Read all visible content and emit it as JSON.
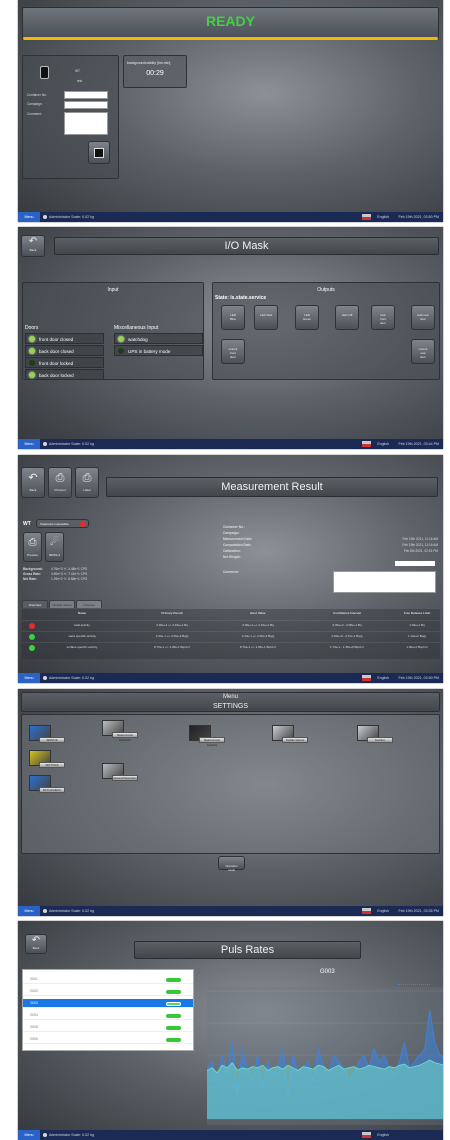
{
  "taskbar": {
    "menu": "Menu",
    "user": "Administrator  Scale: 0.02 kg",
    "language": "English"
  },
  "s1": {
    "status": "READY",
    "device_name": "WT",
    "device_sub": "test",
    "fields": {
      "container_no": "Container No:",
      "campaign": "Campaign:",
      "comment": "Comment:"
    },
    "bg_title": "backgroundvalidity [hrs:min]",
    "bg_value": "00:29",
    "time": "Feb 19th 2021, 03:50 PM"
  },
  "s2": {
    "back": "Back",
    "title": "I/O Mask",
    "input_title": "Input",
    "doors_title": "Doors",
    "doors": [
      {
        "label": "front door closed",
        "on": true
      },
      {
        "label": "back door closed",
        "on": true
      },
      {
        "label": "front door locked",
        "on": false
      },
      {
        "label": "back door locked",
        "on": true
      }
    ],
    "misc_title": "Miscellaneous Input",
    "misc": [
      {
        "label": "watchdog",
        "on": true
      },
      {
        "label": "UPS in battery mode",
        "on": false
      }
    ],
    "outputs_title": "Outputs",
    "state": "State: is.state.service",
    "output_buttons": [
      "LED\nBlue",
      "LED Red",
      "LED\nGreen",
      "LED Off",
      "lock\nfront\ndoor",
      "lock rear\ndoor",
      "unlock\nfront\ndoor",
      "unlock\nrear\ndoor"
    ],
    "time": "Feb 19th 2021, 03:44 PM"
  },
  "s3": {
    "buttons": [
      "Back",
      "Protocol",
      "Label"
    ],
    "title": "Measurement Result",
    "device": "WT",
    "badge": "Clearance impossible",
    "sub_buttons": [
      "Preview",
      "MRSS-2"
    ],
    "stats": [
      {
        "k": "Background:",
        "v": "4.76e+3 +/- 4.48e+1 CPS"
      },
      {
        "k": "Gross Rate:",
        "v": "4.90e+3 +/- 7.41e+1 CPS"
      },
      {
        "k": "Net Rate:",
        "v": "1.29e+2 +/- 8.58e+1 CPS"
      }
    ],
    "info_labels": [
      "Container No.:",
      "Campaign:",
      "Measurement Date:",
      "Computation Date:",
      "Calibration:",
      "Net Weight:",
      "Comment:"
    ],
    "info_values": [
      "",
      "",
      "Feb 19th 2021, 11:16 AM",
      "Feb 19th 2021, 11:16 AM",
      "Feb 8th 2021, 02:15 PM",
      "",
      ""
    ],
    "tabs": [
      "Overview",
      "Nuclide Vector",
      "Channel"
    ],
    "headers": [
      "Name",
      "Primary Result",
      "Best Value",
      "Confidence Interval",
      "Free Release Limit"
    ],
    "rows": [
      {
        "color": "#e52b2b",
        "cells": [
          "total activity",
          "2.30e+1 +/- 2.10e+1 Bq",
          "2.30e+1 +/- 2.10e+1 Bq",
          "0.00e+0 - 2.08e+1 Bq",
          "1.00e+1 Bq"
        ]
      },
      {
        "color": "#3ad13a",
        "cells": [
          "mass specific activity",
          "2.34e-1 +/- 2.06e-2 Bq/g",
          "2.34e-1 +/- 2.06e-2 Bq/g",
          "0.00e+0 - 2.67e-1 Bq/g",
          "1.10e+0 Bq/g"
        ]
      },
      {
        "color": "#3ad13a",
        "cells": [
          "surface specific activity",
          "8.70e-1 +/- 1.05e-1 Bq/cm²",
          "8.70e-1 +/- 1.05e-1 Bq/cm²",
          "1.73e-1 - 1.35e+0 Bq/cm²",
          "1.00e+0 Bq/cm²"
        ]
      }
    ],
    "time": "Feb 19th 2021, 03:50 PM"
  },
  "s4": {
    "menu": "Menu",
    "settings": "SETTINGS",
    "tiles": [
      "SERVICE",
      "Measurement\nParameter",
      "Measurement Capacity",
      "Nuclide Vectors",
      "Nuclides",
      "SETTINGS",
      "General Parameters",
      "BATCHCHECK"
    ],
    "operation": "Operation\nmode",
    "time": "Feb 19th 2021, 03:35 PM"
  },
  "s5": {
    "back": "Back",
    "title": "Puls Rates",
    "items": [
      "G001",
      "G002",
      "G003",
      "G004",
      "G005",
      "G006"
    ],
    "selected": 2,
    "chart_data": {
      "type": "area",
      "title": "G003",
      "series": [
        {
          "values": [
            40,
            45,
            30,
            50,
            35,
            60,
            20,
            55,
            40,
            30,
            50,
            25,
            45,
            35,
            40,
            55,
            20,
            50,
            35,
            40,
            45,
            30,
            55,
            40,
            35,
            50,
            45,
            40,
            30,
            35,
            45,
            50,
            40,
            55,
            45,
            50,
            40,
            35,
            45,
            60,
            40,
            45,
            50,
            55,
            85,
            60,
            50,
            48
          ]
        },
        {
          "values": [
            38,
            40,
            36,
            42,
            40,
            44,
            38,
            40,
            39,
            41,
            40,
            42,
            38,
            40,
            41,
            39,
            42,
            40,
            38,
            41,
            40,
            39,
            42,
            41,
            38,
            40,
            42,
            39,
            40,
            41,
            39,
            40,
            42,
            41,
            40,
            39,
            41,
            40,
            42,
            43,
            40,
            41,
            42,
            44,
            46,
            44,
            43,
            42
          ]
        }
      ],
      "ylim": [
        0,
        100
      ]
    },
    "time": ""
  },
  "colors": {
    "ready": "#3fd43f",
    "accent": "#f5b800",
    "select": "#1978e6"
  }
}
